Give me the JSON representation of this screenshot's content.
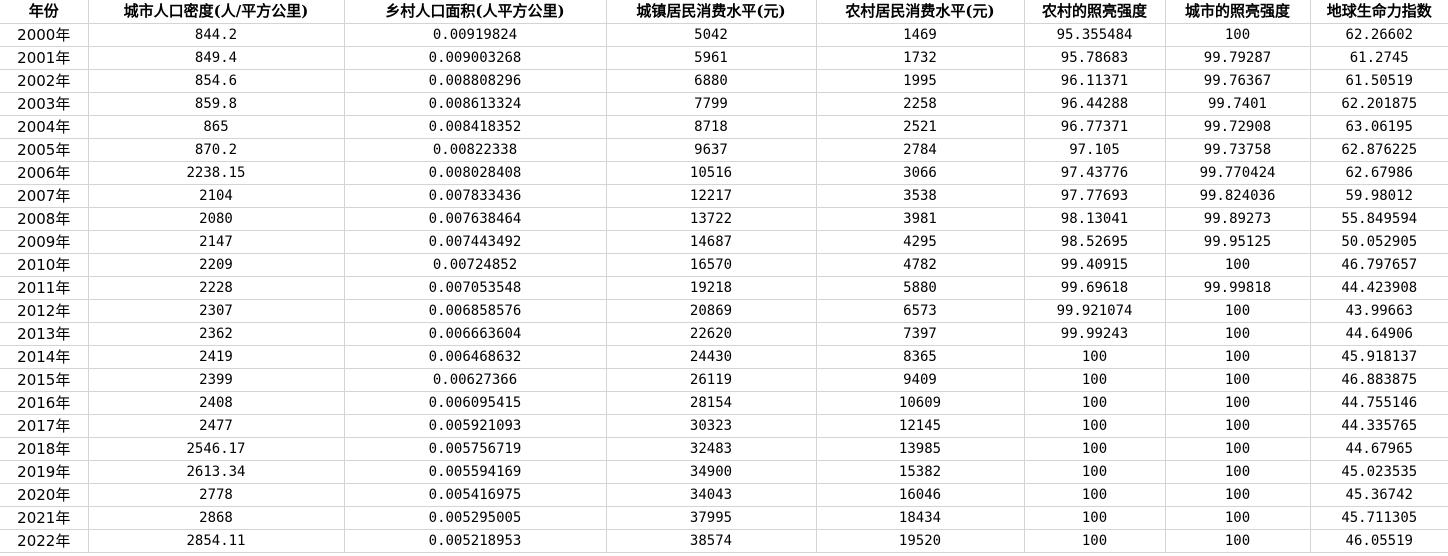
{
  "table": {
    "headers": [
      "年份",
      "城市人口密度(人/平方公里)",
      "乡村人口面积(人平方公里)",
      "城镇居民消费水平(元)",
      "农村居民消费水平(元)",
      "农村的照亮强度",
      "城市的照亮强度",
      "地球生命力指数"
    ],
    "rows": [
      [
        "2000年",
        "844.2",
        "0.00919824",
        "5042",
        "1469",
        "95.355484",
        "100",
        "62.26602"
      ],
      [
        "2001年",
        "849.4",
        "0.009003268",
        "5961",
        "1732",
        "95.78683",
        "99.79287",
        "61.2745"
      ],
      [
        "2002年",
        "854.6",
        "0.008808296",
        "6880",
        "1995",
        "96.11371",
        "99.76367",
        "61.50519"
      ],
      [
        "2003年",
        "859.8",
        "0.008613324",
        "7799",
        "2258",
        "96.44288",
        "99.7401",
        "62.201875"
      ],
      [
        "2004年",
        "865",
        "0.008418352",
        "8718",
        "2521",
        "96.77371",
        "99.72908",
        "63.06195"
      ],
      [
        "2005年",
        "870.2",
        "0.00822338",
        "9637",
        "2784",
        "97.105",
        "99.73758",
        "62.876225"
      ],
      [
        "2006年",
        "2238.15",
        "0.008028408",
        "10516",
        "3066",
        "97.43776",
        "99.770424",
        "62.67986"
      ],
      [
        "2007年",
        "2104",
        "0.007833436",
        "12217",
        "3538",
        "97.77693",
        "99.824036",
        "59.98012"
      ],
      [
        "2008年",
        "2080",
        "0.007638464",
        "13722",
        "3981",
        "98.13041",
        "99.89273",
        "55.849594"
      ],
      [
        "2009年",
        "2147",
        "0.007443492",
        "14687",
        "4295",
        "98.52695",
        "99.95125",
        "50.052905"
      ],
      [
        "2010年",
        "2209",
        "0.00724852",
        "16570",
        "4782",
        "99.40915",
        "100",
        "46.797657"
      ],
      [
        "2011年",
        "2228",
        "0.007053548",
        "19218",
        "5880",
        "99.69618",
        "99.99818",
        "44.423908"
      ],
      [
        "2012年",
        "2307",
        "0.006858576",
        "20869",
        "6573",
        "99.921074",
        "100",
        "43.99663"
      ],
      [
        "2013年",
        "2362",
        "0.006663604",
        "22620",
        "7397",
        "99.99243",
        "100",
        "44.64906"
      ],
      [
        "2014年",
        "2419",
        "0.006468632",
        "24430",
        "8365",
        "100",
        "100",
        "45.918137"
      ],
      [
        "2015年",
        "2399",
        "0.00627366",
        "26119",
        "9409",
        "100",
        "100",
        "46.883875"
      ],
      [
        "2016年",
        "2408",
        "0.006095415",
        "28154",
        "10609",
        "100",
        "100",
        "44.755146"
      ],
      [
        "2017年",
        "2477",
        "0.005921093",
        "30323",
        "12145",
        "100",
        "100",
        "44.335765"
      ],
      [
        "2018年",
        "2546.17",
        "0.005756719",
        "32483",
        "13985",
        "100",
        "100",
        "44.67965"
      ],
      [
        "2019年",
        "2613.34",
        "0.005594169",
        "34900",
        "15382",
        "100",
        "100",
        "45.023535"
      ],
      [
        "2020年",
        "2778",
        "0.005416975",
        "34043",
        "16046",
        "100",
        "100",
        "45.36742"
      ],
      [
        "2021年",
        "2868",
        "0.005295005",
        "37995",
        "18434",
        "100",
        "100",
        "45.711305"
      ],
      [
        "2022年",
        "2854.11",
        "0.005218953",
        "38574",
        "19520",
        "100",
        "100",
        "46.05519"
      ]
    ]
  }
}
